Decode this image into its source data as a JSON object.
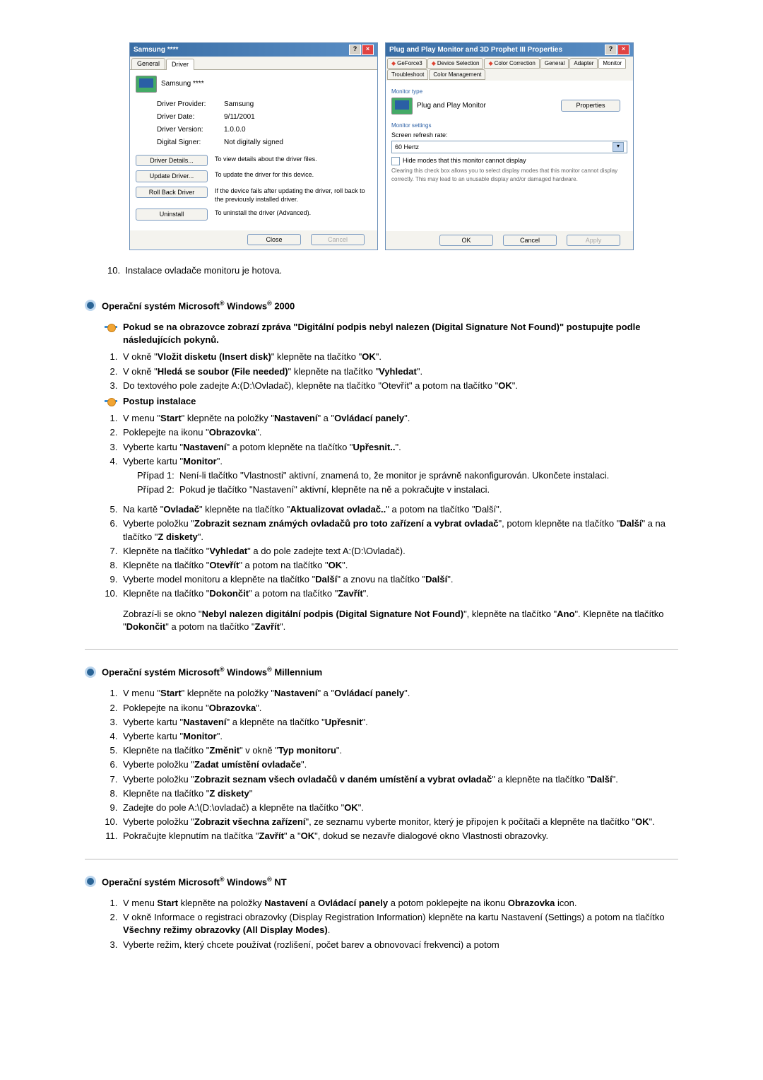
{
  "dialog1": {
    "title": "Samsung ****",
    "tabs": {
      "general": "General",
      "driver": "Driver"
    },
    "device_name": "Samsung ****",
    "rows": {
      "provider_lbl": "Driver Provider:",
      "provider_val": "Samsung",
      "date_lbl": "Driver Date:",
      "date_val": "9/11/2001",
      "version_lbl": "Driver Version:",
      "version_val": "1.0.0.0",
      "signer_lbl": "Digital Signer:",
      "signer_val": "Not digitally signed"
    },
    "btns": {
      "details": "Driver Details...",
      "details_desc": "To view details about the driver files.",
      "update": "Update Driver...",
      "update_desc": "To update the driver for this device.",
      "rollback": "Roll Back Driver",
      "rollback_desc": "If the device fails after updating the driver, roll back to the previously installed driver.",
      "uninstall": "Uninstall",
      "uninstall_desc": "To uninstall the driver (Advanced)."
    },
    "footer": {
      "close": "Close",
      "cancel": "Cancel"
    }
  },
  "dialog2": {
    "title": "Plug and Play Monitor and 3D Prophet III Properties",
    "tabs": {
      "geforce": "GeForce3",
      "device_sel": "Device Selection",
      "color_corr": "Color Correction",
      "general": "General",
      "adapter": "Adapter",
      "monitor": "Monitor",
      "troubleshoot": "Troubleshoot",
      "color_mgmt": "Color Management"
    },
    "monitor_type_hdr": "Monitor type",
    "monitor_type_val": "Plug and Play Monitor",
    "properties_btn": "Properties",
    "monitor_settings_hdr": "Monitor settings",
    "refresh_lbl": "Screen refresh rate:",
    "refresh_val": "60 Hertz",
    "hide_modes": "Hide modes that this monitor cannot display",
    "hide_desc": "Clearing this check box allows you to select display modes that this monitor cannot display correctly. This may lead to an unusable display and/or damaged hardware.",
    "footer": {
      "ok": "OK",
      "cancel": "Cancel",
      "apply": "Apply"
    }
  },
  "step10": {
    "num": "10.",
    "text": "Instalace ovladače monitoru je hotova."
  },
  "win2000": {
    "header": "Operační systém Microsoft® Windows® 2000",
    "note": "Pokud se na obrazovce zobrazí zpráva \"Digitální podpis nebyl nalezen (Digital Signature Not Found)\" postupujte podle následujících pokynů.",
    "s1": "V okně \"Vložit disketu (Insert disk)\" klepněte na tlačítko \"OK\".",
    "s2": "V okně \"Hledá se soubor (File needed)\" klepněte na tlačítko \"Vyhledat\".",
    "s3": "Do textového pole zadejte A:(D:\\Ovladač), klepněte na tlačítko \"Otevřít\" a potom na tlačítko \"OK\".",
    "postup": "Postup instalace",
    "p1": "V menu \"Start\" klepněte na položky \"Nastavení\" a \"Ovládací panely\".",
    "p2": "Poklepejte na ikonu \"Obrazovka\".",
    "p3": "Vyberte kartu \"Nastavení\" a potom klepněte na tlačítko \"Upřesnit..\".",
    "p4": "Vyberte kartu \"Monitor\".",
    "p4c1": "Případ 1:  Není-li tlačítko \"Vlastnosti\" aktivní, znamená to, že monitor je správně nakonfigurován. Ukončete instalaci.",
    "p4c2": "Případ 2:  Pokud je tlačítko \"Nastavení\" aktivní, klepněte na ně a pokračujte v instalaci.",
    "p5": "Na kartě \"Ovladač\" klepněte na tlačítko \"Aktualizovat ovladač..\" a potom na tlačítko \"Další\".",
    "p6": "Vyberte položku \"Zobrazit seznam známých ovladačů pro toto zařízení a vybrat ovladač\", potom klepněte na tlačítko \"Další\" a na tlačítko \"Z diskety\".",
    "p7": "Klepněte na tlačítko \"Vyhledat\" a do pole zadejte text A:(D:\\Ovladač).",
    "p8": "Klepněte na tlačítko \"Otevřít\" a potom na tlačítko \"OK\".",
    "p9": "Vyberte model monitoru a klepněte na tlačítko \"Další\" a znovu na tlačítko \"Další\".",
    "p10": "Klepněte na tlačítko \"Dokončit\" a potom na tlačítko \"Zavřít\".",
    "p10b": "Zobrazí-li se okno \"Nebyl nalezen digitální podpis (Digital Signature Not Found)\", klepněte na tlačítko \"Ano\". Klepněte na tlačítko \"Dokončit\" a potom na tlačítko \"Zavřít\"."
  },
  "winme": {
    "header": "Operační systém Microsoft® Windows® Millennium",
    "m1": "V menu \"Start\" klepněte na položky \"Nastavení\" a \"Ovládací panely\".",
    "m2": "Poklepejte na ikonu \"Obrazovka\".",
    "m3": "Vyberte kartu \"Nastavení\" a klepněte na tlačítko \"Upřesnit\".",
    "m4": "Vyberte kartu \"Monitor\".",
    "m5": "Klepněte na tlačítko \"Změnit\" v okně \"Typ monitoru\".",
    "m6": "Vyberte položku \"Zadat umístění ovladače\".",
    "m7": "Vyberte položku \"Zobrazit seznam všech ovladačů v daném umístění a vybrat ovladač\" a klepněte na tlačítko \"Další\".",
    "m8": "Klepněte na tlačítko \"Z diskety\"",
    "m9": "Zadejte do pole A:\\(D:\\ovladač) a klepněte na tlačítko \"OK\".",
    "m10": "Vyberte položku \"Zobrazit všechna zařízení\", ze seznamu vyberte monitor, který je připojen k počítači a klepněte na tlačítko \"OK\".",
    "m11": "Pokračujte klepnutím na tlačítka \"Zavřít\" a \"OK\", dokud se nezavře dialogové okno Vlastnosti obrazovky."
  },
  "winnt": {
    "header": "Operační systém Microsoft® Windows® NT",
    "n1": "V menu Start klepněte na položky Nastavení a Ovládací panely a potom poklepejte na ikonu Obrazovka icon.",
    "n2": "V okně Informace o registraci obrazovky (Display Registration Information) klepněte na kartu Nastavení (Settings) a potom na tlačítko Všechny režimy obrazovky (All Display Modes).",
    "n3": "Vyberte režim, který chcete používat (rozlišení, počet barev a obnovovací frekvenci) a potom"
  }
}
